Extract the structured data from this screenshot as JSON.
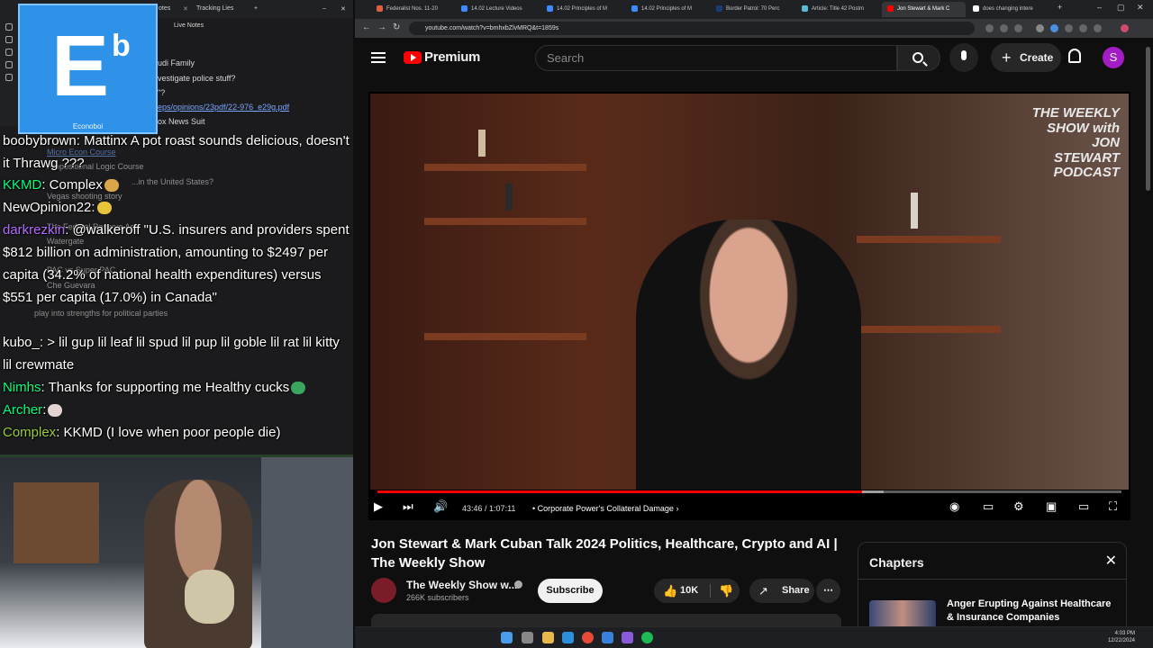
{
  "left_pane": {
    "tabs": [
      "otes",
      "Tracking Lies"
    ],
    "panel_title": "Live Notes",
    "logo": {
      "letter": "E",
      "superscript": "b",
      "caption": "Econoboi"
    },
    "notes": [
      "udi Family",
      "vestigate police stuff?",
      "\"?",
      "eps/opinions/23pdf/22-976_e29g.pdf",
      "ox News Suit",
      "Micro Econ Course",
      "Propositional Logic Course",
      "...in the United States?",
      "Vegas shooting story",
      "The Federal Reserve Act",
      "Watergate",
      "PAC vs Super PAC",
      "Che Guevara",
      "play into strengths for political parties"
    ],
    "chat": [
      {
        "user": "boobybrown",
        "text": ": Mattinx A pot roast sounds delicious, doesn't it Thrawg ???",
        "color": "#ffffff"
      },
      {
        "user": "KKMD",
        "text": ": Complex",
        "color": "#00ff7f"
      },
      {
        "user": "NewOpinion22",
        "text": ":",
        "color": "#ffffff"
      },
      {
        "user": "darkrezkin",
        "text": ": @walkeroff \"U.S. insurers and providers spent $812 billion on administration, amounting to $2497 per capita (34.2% of national health expenditures) versus $551 per capita (17.0%) in Canada\"",
        "color": "#b36bff"
      },
      {
        "user": "kubo_",
        "text": ": > lil gup  lil leaf  lil spud  lil pup  lil goble  lil rat  lil kitty  lil crewmate",
        "color": "#ffffff"
      },
      {
        "user": "Nimhs",
        "text": ": Thanks for supporting me Healthy cucks",
        "color": "#00ff7f"
      },
      {
        "user": "Archer",
        "text": ":",
        "color": "#00ff7f"
      },
      {
        "user": "Complex",
        "text": ": KKMD (I love when poor people die)",
        "color": "#9acd32"
      }
    ]
  },
  "browser": {
    "tabs": [
      {
        "label": "Federalist Nos. 11-20",
        "color": "#e05d44"
      },
      {
        "label": "14.02 Lecture Videos",
        "color": "#3d8bff"
      },
      {
        "label": "14.02 Principles of M",
        "color": "#3d8bff"
      },
      {
        "label": "14.02 Principles of M",
        "color": "#3d8bff"
      },
      {
        "label": "Border Patrol: 70 Perc",
        "color": "#1a3c78"
      },
      {
        "label": "Article: Title 42 Postm",
        "color": "#5bb8d9"
      },
      {
        "label": "Jon Stewart & Mark C",
        "color": "#ff0000",
        "active": true
      },
      {
        "label": "does changing intere",
        "color": "#ffffff"
      }
    ],
    "url": "youtube.com/watch?v=bmhxbZlvMRQ&t=1859s"
  },
  "youtube": {
    "brand": "Premium",
    "search_placeholder": "Search",
    "create_label": "Create",
    "avatar_letter": "S",
    "player": {
      "current_time": "43:46",
      "duration": "1:07:11",
      "time_sep": " / ",
      "chapter": "• Corporate Power's Collateral Damage  ›",
      "progress": 0.651,
      "buffered": 0.68,
      "podcast_logo": "THE WEEKLY SHOW with JON STEWART PODCAST"
    },
    "video_title": "Jon Stewart & Mark Cuban Talk 2024 Politics, Healthcare, Crypto and AI | The Weekly Show",
    "channel_name": "The Weekly Show w...",
    "subscribers": "266K subscribers",
    "subscribe_label": "Subscribe",
    "likes": "10K",
    "share_label": "Share",
    "more_label": "⋯",
    "chapters": {
      "title": "Chapters",
      "item": "Anger Erupting Against Healthcare & Insurance Companies"
    }
  },
  "taskbar": {
    "time": "4:03 PM",
    "date": "12/22/2024"
  }
}
